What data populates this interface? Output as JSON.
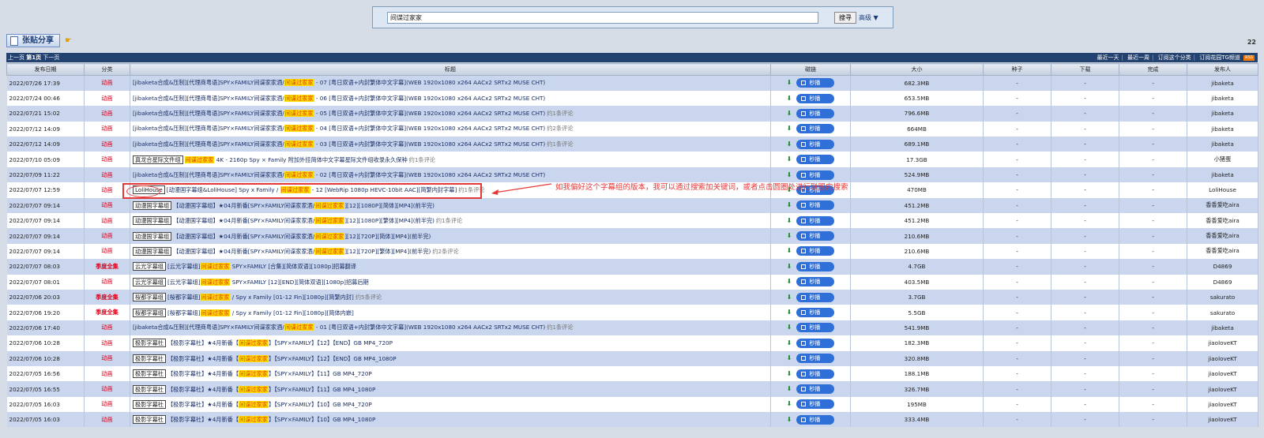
{
  "search": {
    "value": "间谍过家家",
    "button_label": "搜寻",
    "advanced_label": "高级 ▼"
  },
  "toolbar": {
    "share_label": "张贴分享",
    "count": "22"
  },
  "nav": {
    "left": {
      "prev": "上一页",
      "page": "第1页",
      "next": "下一页"
    },
    "right": [
      "最近一天",
      "最近一周",
      "订阅这个分类",
      "订阅花园TG频道"
    ],
    "rss_badge": "RSS"
  },
  "columns": [
    "发布日期",
    "分类",
    "标题",
    "磁链",
    "大小",
    "种子",
    "下载",
    "完成",
    "发布人"
  ],
  "play_label": "秒播",
  "colors": {
    "accent": "#2e6fd8",
    "highlight": "#ffe000",
    "category": "#e0001b",
    "annotation": "#e53838"
  },
  "rows": [
    {
      "date": "2022/07/26 17:39",
      "category": "动画",
      "tag": "",
      "pre": "[jibaketa合成&压制][代理商粤语]SPY×FAMILY间谍家家酒/",
      "hl": "间谍过家家",
      "post": " - 07 [粤日双语+内封繁体中文字幕](WEB 1920x1080 x264 AACx2 SRTx2 MUSE CHT)",
      "comment": "",
      "size": "682.3MB",
      "seeds": "-",
      "downloads": "-",
      "completed": "-",
      "uploader": "jibaketa"
    },
    {
      "date": "2022/07/24 00:46",
      "category": "动画",
      "tag": "",
      "pre": "[jibaketa合成&压制][代理商粤语]SPY×FAMILY间谍家家酒/",
      "hl": "间谍过家家",
      "post": " - 06 [粤日双语+内封繁体中文字幕](WEB 1920x1080 x264 AACx2 SRTx2 MUSE CHT)",
      "comment": "",
      "size": "653.5MB",
      "seeds": "-",
      "downloads": "-",
      "completed": "-",
      "uploader": "jibaketa"
    },
    {
      "date": "2022/07/21 15:02",
      "category": "动画",
      "tag": "",
      "pre": "[jibaketa合成&压制][代理商粤语]SPY×FAMILY间谍家家酒/",
      "hl": "间谍过家家",
      "post": " - 05 [粤日双语+内封繁体中文字幕](WEB 1920x1080 x264 AACx2 SRTx2 MUSE CHT)",
      "comment": "约1条评论",
      "size": "796.6MB",
      "seeds": "-",
      "downloads": "-",
      "completed": "-",
      "uploader": "jibaketa"
    },
    {
      "date": "2022/07/12 14:09",
      "category": "动画",
      "tag": "",
      "pre": "[jibaketa合成&压制][代理商粤语]SPY×FAMILY间谍家家酒/",
      "hl": "间谍过家家",
      "post": " - 04 [粤日双语+内封繁体中文字幕](WEB 1920x1080 x264 AACx2 SRTx2 MUSE CHT)",
      "comment": "约2条评论",
      "size": "664MB",
      "seeds": "-",
      "downloads": "-",
      "completed": "-",
      "uploader": "jibaketa"
    },
    {
      "date": "2022/07/12 14:09",
      "category": "动画",
      "tag": "",
      "pre": "[jibaketa合成&压制][代理商粤语]SPY×FAMILY间谍家家酒/",
      "hl": "间谍过家家",
      "post": " - 03 [粤日双语+内封繁体中文字幕](WEB 1920x1080 x264 AACx2 SRTx2 MUSE CHT)",
      "comment": "约1条评论",
      "size": "689.1MB",
      "seeds": "-",
      "downloads": "-",
      "completed": "-",
      "uploader": "jibaketa"
    },
    {
      "date": "2022/07/10 05:09",
      "category": "动画",
      "tag": "真龙合星际文件组",
      "pre": "",
      "hl": "间谍过家家",
      "post": " 4K - 2160p Spy × Family 附加外挂简体中文字幕星际文件组收录永久保种",
      "comment": "约1条评论",
      "size": "17.3GB",
      "seeds": "-",
      "downloads": "-",
      "completed": "-",
      "uploader": "小猪蛋"
    },
    {
      "date": "2022/07/09 11:22",
      "category": "动画",
      "tag": "",
      "pre": "[jibaketa合成&压制][代理商粤语]SPY×FAMILY间谍家家酒/",
      "hl": "间谍过家家",
      "post": " - 02 [粤日双语+内封繁体中文字幕](WEB 1920x1080 x264 AACx2 SRTx2 MUSE CHT)",
      "comment": "",
      "size": "524.9MB",
      "seeds": "-",
      "downloads": "-",
      "completed": "-",
      "uploader": "jibaketa"
    },
    {
      "date": "2022/07/07 12:59",
      "category": "动画",
      "tag": "LoliHouse",
      "pre": "[动漫国字幕组&LoliHouse] Spy x Family / ",
      "hl": "间谍过家家",
      "post": " - 12 [WebRip 1080p HEVC-10bit AAC][简繁内封字幕]",
      "comment": "约1条评论",
      "size": "470MB",
      "seeds": "-",
      "downloads": "-",
      "completed": "-",
      "uploader": "LoliHouse"
    },
    {
      "date": "2022/07/07 09:14",
      "category": "动画",
      "tag": "动漫国字幕组",
      "pre": "【动漫国字幕组】★04月新番[SPY×FAMILY间谍家家酒/",
      "hl": "间谍过家家",
      "post": "][12][1080P][简体][MP4](前半完)",
      "comment": "",
      "size": "451.2MB",
      "seeds": "-",
      "downloads": "-",
      "completed": "-",
      "uploader": "香香爱吃aira"
    },
    {
      "date": "2022/07/07 09:14",
      "category": "动画",
      "tag": "动漫国字幕组",
      "pre": "【动漫国字幕组】★04月新番[SPY×FAMILY间谍家家酒/",
      "hl": "间谍过家家",
      "post": "][12][1080P][繁体][MP4](前半完)",
      "comment": "约1条评论",
      "size": "451.2MB",
      "seeds": "-",
      "downloads": "-",
      "completed": "-",
      "uploader": "香香爱吃aira"
    },
    {
      "date": "2022/07/07 09:14",
      "category": "动画",
      "tag": "动漫国字幕组",
      "pre": "【动漫国字幕组】★04月新番[SPY×FAMILY间谍家家酒/",
      "hl": "间谍过家家",
      "post": "][12][720P][简体][MP4](前半完)",
      "comment": "",
      "size": "210.6MB",
      "seeds": "-",
      "downloads": "-",
      "completed": "-",
      "uploader": "香香爱吃aira"
    },
    {
      "date": "2022/07/07 09:14",
      "category": "动画",
      "tag": "动漫国字幕组",
      "pre": "【动漫国字幕组】★04月新番[SPY×FAMILY间谍家家酒/",
      "hl": "间谍过家家",
      "post": "][12][720P][繁体][MP4](前半完)",
      "comment": "约2条评论",
      "size": "210.6MB",
      "seeds": "-",
      "downloads": "-",
      "completed": "-",
      "uploader": "香香爱吃aira"
    },
    {
      "date": "2022/07/07 08:03",
      "category": "季度全集",
      "tag": "云光字幕组",
      "pre": "[云光字幕组]",
      "hl": "间谍过家家",
      "post": " SPY×FAMILY [合集][简体双语][1080p]招募翻译",
      "comment": "",
      "size": "4.7GB",
      "seeds": "-",
      "downloads": "-",
      "completed": "-",
      "uploader": "D4869"
    },
    {
      "date": "2022/07/07 08:01",
      "category": "动画",
      "tag": "云光字幕组",
      "pre": "[云光字幕组]",
      "hl": "间谍过家家",
      "post": " SPY×FAMILY [12][END][简体双语][1080p]招募后期",
      "comment": "",
      "size": "403.5MB",
      "seeds": "-",
      "downloads": "-",
      "completed": "-",
      "uploader": "D4869"
    },
    {
      "date": "2022/07/06 20:03",
      "category": "季度全集",
      "tag": "桜都字幕组",
      "pre": "[桜都字幕组]",
      "hl": "间谍过家家",
      "post": " / Spy x Family [01-12 Fin][1080p][简繁内封]",
      "comment": "约5条评论",
      "size": "3.7GB",
      "seeds": "-",
      "downloads": "-",
      "completed": "-",
      "uploader": "sakurato"
    },
    {
      "date": "2022/07/06 19:20",
      "category": "季度全集",
      "tag": "桜都字幕组",
      "pre": "[桜都字幕组]",
      "hl": "间谍过家家",
      "post": " / Spy x Family [01-12 Fin][1080p][简体内嵌]",
      "comment": "",
      "size": "5.5GB",
      "seeds": "-",
      "downloads": "-",
      "completed": "-",
      "uploader": "sakurato"
    },
    {
      "date": "2022/07/06 17:40",
      "category": "动画",
      "tag": "",
      "pre": "[jibaketa合成&压制][代理商粤语]SPY×FAMILY间谍家家酒/",
      "hl": "间谍过家家",
      "post": " - 01 [粤日双语+内封繁体中文字幕](WEB 1920x1080 x264 AACx2 SRTx2 MUSE CHT)",
      "comment": "约1条评论",
      "size": "541.9MB",
      "seeds": "-",
      "downloads": "-",
      "completed": "-",
      "uploader": "jibaketa"
    },
    {
      "date": "2022/07/06 10:28",
      "category": "动画",
      "tag": "极影字幕社",
      "pre": "【极影字幕社】★4月新番【",
      "hl": "间谍过家家",
      "post": "】【SPY×FAMILY】【12】【END】GB MP4_720P",
      "comment": "",
      "size": "182.3MB",
      "seeds": "-",
      "downloads": "-",
      "completed": "-",
      "uploader": "jiaoloveKT"
    },
    {
      "date": "2022/07/06 10:28",
      "category": "动画",
      "tag": "极影字幕社",
      "pre": "【极影字幕社】★4月新番【",
      "hl": "间谍过家家",
      "post": "】【SPY×FAMILY】【12】【END】GB MP4_1080P",
      "comment": "",
      "size": "320.8MB",
      "seeds": "-",
      "downloads": "-",
      "completed": "-",
      "uploader": "jiaoloveKT"
    },
    {
      "date": "2022/07/05 16:56",
      "category": "动画",
      "tag": "极影字幕社",
      "pre": "【极影字幕社】★4月新番【",
      "hl": "间谍过家家",
      "post": "】【SPY×FAMILY】【11】GB MP4_720P",
      "comment": "",
      "size": "188.1MB",
      "seeds": "-",
      "downloads": "-",
      "completed": "-",
      "uploader": "jiaoloveKT"
    },
    {
      "date": "2022/07/05 16:55",
      "category": "动画",
      "tag": "极影字幕社",
      "pre": "【极影字幕社】★4月新番【",
      "hl": "间谍过家家",
      "post": "】【SPY×FAMILY】【11】GB MP4_1080P",
      "comment": "",
      "size": "326.7MB",
      "seeds": "-",
      "downloads": "-",
      "completed": "-",
      "uploader": "jiaoloveKT"
    },
    {
      "date": "2022/07/05 16:03",
      "category": "动画",
      "tag": "极影字幕社",
      "pre": "【极影字幕社】★4月新番【",
      "hl": "间谍过家家",
      "post": "】【SPY×FAMILY】【10】GB MP4_720P",
      "comment": "",
      "size": "195MB",
      "seeds": "-",
      "downloads": "-",
      "completed": "-",
      "uploader": "jiaoloveKT"
    },
    {
      "date": "2022/07/05 16:03",
      "category": "动画",
      "tag": "极影字幕社",
      "pre": "【极影字幕社】★4月新番【",
      "hl": "间谍过家家",
      "post": "】【SPY×FAMILY】【10】GB MP4_1080P",
      "comment": "",
      "size": "333.4MB",
      "seeds": "-",
      "downloads": "-",
      "completed": "-",
      "uploader": "jiaoloveKT"
    }
  ],
  "annotation": {
    "text": "如我偏好这个字幕组的版本，我可以通过搜索加关键词，或者点击圆圈处进行联盟内搜索"
  }
}
